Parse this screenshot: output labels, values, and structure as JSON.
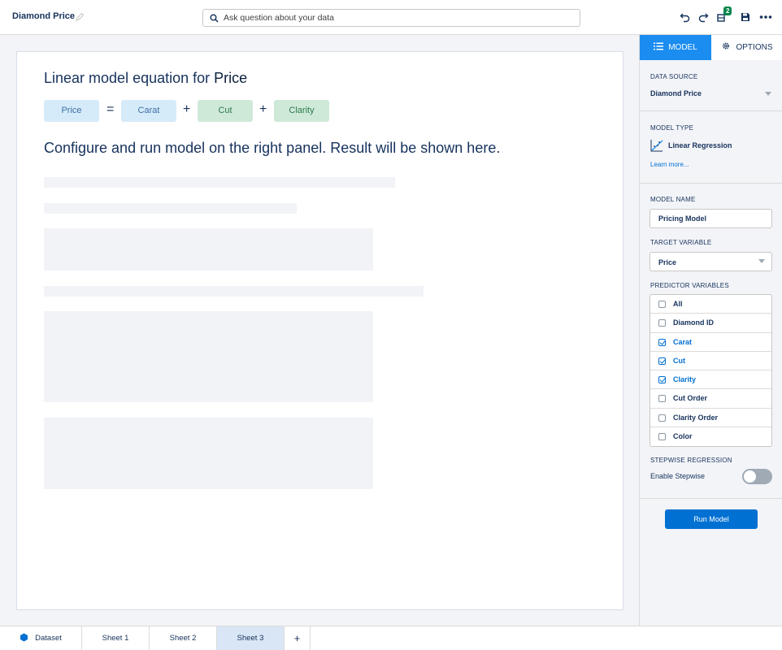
{
  "header": {
    "title": "Diamond Price",
    "search_placeholder": "Ask question about your data",
    "badge_count": "2"
  },
  "equation": {
    "title_prefix": "Linear model equation for",
    "title_target": "Price",
    "target": "Price",
    "equals": "=",
    "plus": "+",
    "predictors": [
      "Carat",
      "Cut",
      "Clarity"
    ]
  },
  "hint": "Configure and run model on the right panel. Result will be shown here.",
  "panel": {
    "tabs": [
      {
        "label": "MODEL",
        "icon": "list-icon",
        "active": true
      },
      {
        "label": "OPTIONS",
        "icon": "gear-icon",
        "active": false
      }
    ],
    "data_source": {
      "label": "DATA SOURCE",
      "value": "Diamond Price"
    },
    "model_type": {
      "label": "MODEL TYPE",
      "value": "Linear Regression",
      "link": "Learn more..."
    },
    "model_name": {
      "label": "MODEL NAME",
      "value": "Pricing Model"
    },
    "target_variable": {
      "label": "TARGET VARIABLE",
      "value": "Price"
    },
    "predictor_variables": {
      "label": "PREDICTOR VARIABLES",
      "items": [
        {
          "label": "All",
          "checked": false
        },
        {
          "label": "Diamond ID",
          "checked": false
        },
        {
          "label": "Carat",
          "checked": true
        },
        {
          "label": "Cut",
          "checked": true
        },
        {
          "label": "Clarity",
          "checked": true
        },
        {
          "label": "Cut Order",
          "checked": false
        },
        {
          "label": "Clarity Order",
          "checked": false
        },
        {
          "label": "Color",
          "checked": false
        }
      ]
    },
    "stepwise": {
      "label": "STEPWISE REGRESSION",
      "toggle_label": "Enable Stepwise",
      "enabled": false
    },
    "run_button": "Run Model"
  },
  "bottom_tabs": [
    {
      "label": "Dataset",
      "icon": "dataset-icon",
      "active": false
    },
    {
      "label": "Sheet 1",
      "active": false
    },
    {
      "label": "Sheet 2",
      "active": false
    },
    {
      "label": "Sheet 3",
      "active": true
    },
    {
      "label": "+",
      "active": false
    }
  ],
  "colors": {
    "accent": "#1b8cf0",
    "primary_button": "#0070d2",
    "badge": "#04844b",
    "chip_blue": "#d6ebfa",
    "chip_green": "#cfe9d9"
  }
}
